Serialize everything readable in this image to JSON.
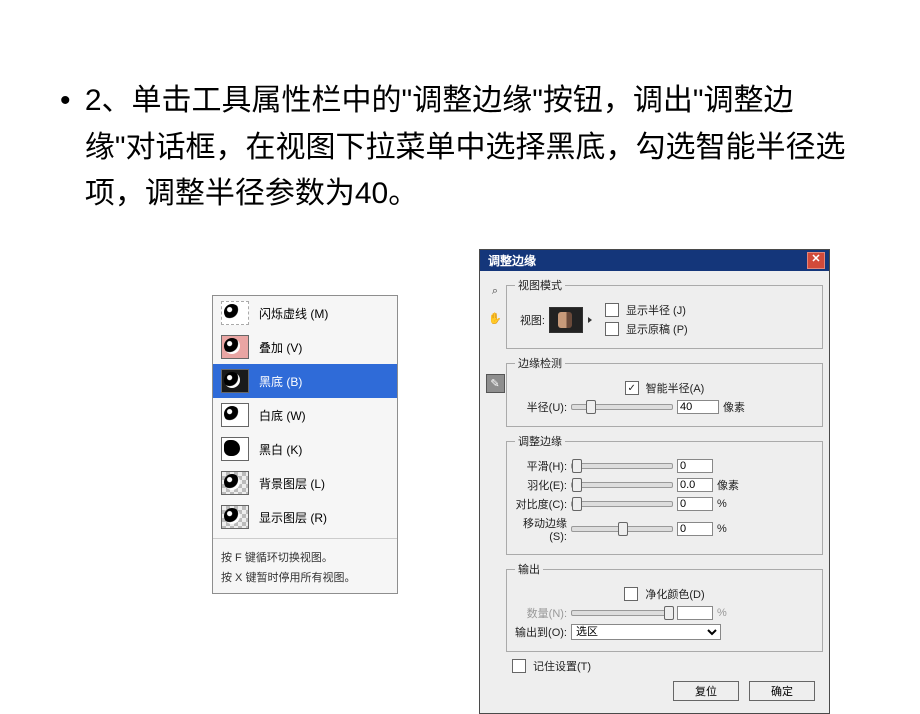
{
  "instruction": {
    "bullet": "•",
    "text": "2、单击工具属性栏中的\"调整边缘\"按钮，调出\"调整边缘\"对话框，在视图下拉菜单中选择黑底，勾选智能半径选项，调整半径参数为40。"
  },
  "view_menu": {
    "items": [
      {
        "label": "闪烁虚线 (M)",
        "thumbClass": "dashed"
      },
      {
        "label": "叠加 (V)",
        "thumbClass": "pink"
      },
      {
        "label": "黑底 (B)",
        "thumbClass": "black",
        "selected": true
      },
      {
        "label": "白底 (W)",
        "thumbClass": "white"
      },
      {
        "label": "黑白 (K)",
        "thumbClass": "bw"
      },
      {
        "label": "背景图层 (L)",
        "thumbClass": "checker"
      },
      {
        "label": "显示图层 (R)",
        "thumbClass": "checker"
      }
    ],
    "footnote1": "按 F 键循环切换视图。",
    "footnote2": "按 X 键暂时停用所有视图。"
  },
  "dialog": {
    "title": "调整边缘",
    "sections": {
      "view_mode": {
        "legend": "视图模式",
        "view_label": "视图:",
        "show_radius": "显示半径 (J)",
        "show_original": "显示原稿 (P)"
      },
      "edge_detect": {
        "legend": "边缘检测",
        "smart_radius": "智能半径(A)",
        "smart_radius_checked": true,
        "radius_label": "半径(U):",
        "radius_value": "40",
        "radius_unit": "像素"
      },
      "adjust_edge": {
        "legend": "调整边缘",
        "smooth_label": "平滑(H):",
        "smooth_value": "0",
        "feather_label": "羽化(E):",
        "feather_value": "0.0",
        "feather_unit": "像素",
        "contrast_label": "对比度(C):",
        "contrast_value": "0",
        "contrast_unit": "%",
        "shift_label": "移动边缘(S):",
        "shift_value": "0",
        "shift_unit": "%"
      },
      "output": {
        "legend": "输出",
        "purify_label": "净化颜色(D)",
        "amount_label": "数量(N):",
        "amount_value": "",
        "amount_unit": "%",
        "output_to_label": "输出到(O):",
        "output_to_value": "选区"
      }
    },
    "remember": "记住设置(T)",
    "reset": "复位",
    "ok": "确定"
  }
}
